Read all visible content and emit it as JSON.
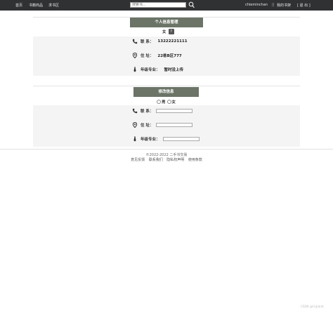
{
  "nav": {
    "home": "首页",
    "book_products": "书籍商品",
    "seek_books": "求书区",
    "search_placeholder": "搜索书...",
    "username": "chieminchan",
    "separator": "||",
    "my_shelf": "我的书架",
    "logout": "[ 退 出 ]"
  },
  "info": {
    "title": "个人信息管理",
    "gender": "女",
    "help_badge": "?",
    "phone_label": "联     系：",
    "phone_value": "13222221111",
    "address_label": "住     址：",
    "address_value": "22栋B区777",
    "grade_label": "年级专业：",
    "grade_value": "暂时没上传"
  },
  "edit": {
    "title": "修改信息",
    "gender_male": "男",
    "gender_female": "女",
    "phone_label": "联     系：",
    "address_label": "住     址：",
    "grade_label": "年级专业："
  },
  "footer": {
    "copyright": "©2022-2022 二手书交易",
    "links": [
      "意见反馈",
      "联系我们",
      "隐私权声明",
      "使用条款"
    ]
  },
  "watermark": "CSDN @行走年的"
}
